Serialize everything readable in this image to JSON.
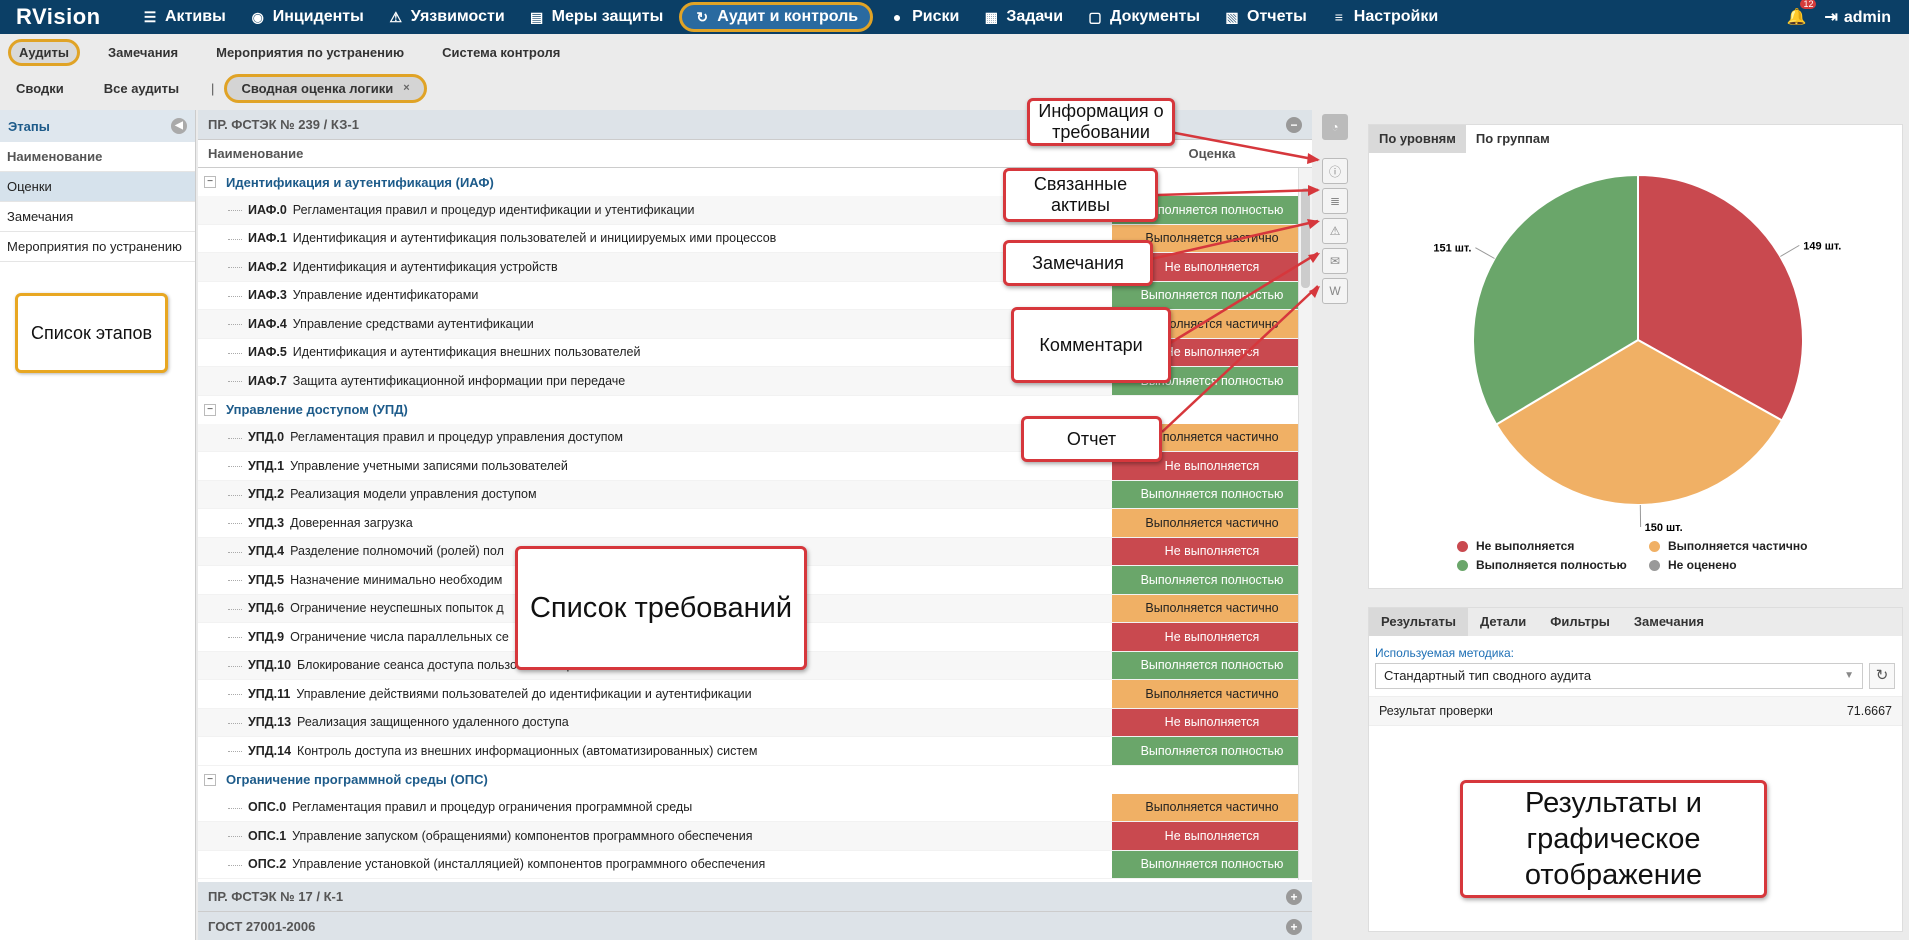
{
  "app": {
    "logo": "RVision"
  },
  "topnav": {
    "items": [
      {
        "label": "Активы",
        "icon": "database-icon",
        "glyph": "☰"
      },
      {
        "label": "Инциденты",
        "icon": "target-icon",
        "glyph": "◉"
      },
      {
        "label": "Уязвимости",
        "icon": "warning-icon",
        "glyph": "⚠"
      },
      {
        "label": "Меры защиты",
        "icon": "shield-list-icon",
        "glyph": "▤"
      },
      {
        "label": "Аудит и контроль",
        "icon": "audit-refresh-icon",
        "glyph": "↻"
      },
      {
        "label": "Риски",
        "icon": "alert-circle-icon",
        "glyph": "●"
      },
      {
        "label": "Задачи",
        "icon": "tasks-icon",
        "glyph": "▦"
      },
      {
        "label": "Документы",
        "icon": "document-icon",
        "glyph": "▢"
      },
      {
        "label": "Отчеты",
        "icon": "report-icon",
        "glyph": "▧"
      },
      {
        "label": "Настройки",
        "icon": "menu-icon",
        "glyph": "≡"
      }
    ],
    "notifications_count": "12",
    "user": "admin"
  },
  "subtabs": [
    "Аудиты",
    "Замечания",
    "Мероприятия по устранению",
    "Система контроля"
  ],
  "subsub": {
    "summaries": "Сводки",
    "all_audits": "Все аудиты",
    "separator": "|",
    "active_tab": "Сводная оценка логики",
    "close": "×"
  },
  "stages": {
    "title": "Этапы",
    "header": "Наименование",
    "items": [
      "Оценки",
      "Замечания",
      "Мероприятия по устранению"
    ]
  },
  "requirements": {
    "section_title": "ПР. ФСТЭК № 239 / КЗ-1",
    "col_name": "Наименование",
    "col_score": "Оценка",
    "groups": [
      {
        "title": "Идентификация и аутентификация (ИАФ)",
        "rows": [
          {
            "code": "ИАФ.0",
            "name": "Регламентация правил и процедур идентификации и утентификации",
            "status": "Выполняется полностью",
            "cls": "st-green"
          },
          {
            "code": "ИАФ.1",
            "name": "Идентификация и аутентификация пользователей и инициируемых ими процессов",
            "status": "Выполняется частично",
            "cls": "st-orange"
          },
          {
            "code": "ИАФ.2",
            "name": "Идентификация и аутентификация устройств",
            "status": "Не выполняется",
            "cls": "st-red"
          },
          {
            "code": "ИАФ.3",
            "name": "Управление идентификаторами",
            "status": "Выполняется полностью",
            "cls": "st-green"
          },
          {
            "code": "ИАФ.4",
            "name": "Управление средствами аутентификации",
            "status": "Выполняется частично",
            "cls": "st-orange"
          },
          {
            "code": "ИАФ.5",
            "name": "Идентификация и аутентификация внешних пользователей",
            "status": "Не выполняется",
            "cls": "st-red"
          },
          {
            "code": "ИАФ.7",
            "name": "Защита аутентификационной информации при передаче",
            "status": "Выполняется полностью",
            "cls": "st-green"
          }
        ]
      },
      {
        "title": "Управление доступом (УПД)",
        "rows": [
          {
            "code": "УПД.0",
            "name": "Регламентация правил и процедур управления доступом",
            "status": "Выполняется частично",
            "cls": "st-orange"
          },
          {
            "code": "УПД.1",
            "name": "Управление учетными записями пользователей",
            "status": "Не выполняется",
            "cls": "st-red"
          },
          {
            "code": "УПД.2",
            "name": "Реализация модели управления доступом",
            "status": "Выполняется полностью",
            "cls": "st-green"
          },
          {
            "code": "УПД.3",
            "name": "Доверенная загрузка",
            "status": "Выполняется частично",
            "cls": "st-orange"
          },
          {
            "code": "УПД.4",
            "name": "Разделение полномочий (ролей) пол",
            "status": "Не выполняется",
            "cls": "st-red"
          },
          {
            "code": "УПД.5",
            "name": "Назначение минимально необходим",
            "status": "Выполняется полностью",
            "cls": "st-green"
          },
          {
            "code": "УПД.6",
            "name": "Ограничение неуспешных попыток д                                                         ) систему",
            "status": "Выполняется частично",
            "cls": "st-orange"
          },
          {
            "code": "УПД.9",
            "name": "Ограничение числа параллельных се",
            "status": "Не выполняется",
            "cls": "st-red"
          },
          {
            "code": "УПД.10",
            "name": "Блокирование сеанса доступа пользователя при неактивности",
            "status": "Выполняется полностью",
            "cls": "st-green"
          },
          {
            "code": "УПД.11",
            "name": "Управление действиями пользователей до идентификации и аутентификации",
            "status": "Выполняется частично",
            "cls": "st-orange"
          },
          {
            "code": "УПД.13",
            "name": "Реализация защищенного удаленного доступа",
            "status": "Не выполняется",
            "cls": "st-red"
          },
          {
            "code": "УПД.14",
            "name": "Контроль доступа из внешних информационных (автоматизированных) систем",
            "status": "Выполняется полностью",
            "cls": "st-green"
          }
        ]
      },
      {
        "title": "Ограничение программной среды (ОПС)",
        "rows": [
          {
            "code": "ОПС.0",
            "name": "Регламентация правил и процедур ограничения программной среды",
            "status": "Выполняется частично",
            "cls": "st-orange"
          },
          {
            "code": "ОПС.1",
            "name": "Управление запуском (обращениями) компонентов программного обеспечения",
            "status": "Не выполняется",
            "cls": "st-red"
          },
          {
            "code": "ОПС.2",
            "name": "Управление установкой (инсталляцией) компонентов программного обеспечения",
            "status": "Выполняется полностью",
            "cls": "st-green"
          }
        ]
      }
    ],
    "collapsed_sections": [
      "ПР. ФСТЭК № 17 / К-1",
      "ГОСТ 27001-2006"
    ]
  },
  "chart_tabs": [
    "По уровням",
    "По группам"
  ],
  "chart_data": {
    "type": "pie",
    "slices": [
      {
        "label": "Не выполняется",
        "value": 149,
        "display": "149 шт.",
        "color": "#c9494f"
      },
      {
        "label": "Выполняется частично",
        "value": 150,
        "display": "150 шт.",
        "color": "#f0b065"
      },
      {
        "label": "Выполняется полностью",
        "value": 151,
        "display": "151 шт.",
        "color": "#6aa66a"
      },
      {
        "label": "Не оценено",
        "value": 0,
        "display": "",
        "color": "#999999"
      }
    ],
    "legend_placement": "bottom"
  },
  "results": {
    "tabs": [
      "Результаты",
      "Детали",
      "Фильтры",
      "Замечания"
    ],
    "method_label": "Используемая методика:",
    "method_value": "Стандартный тип сводного аудита",
    "check_label": "Результат проверки",
    "check_value": "71.6667"
  },
  "callouts": {
    "info": "Информация о требовании",
    "assets": "Связанные активы",
    "remarks": "Замечания",
    "comments": "Комментари",
    "report": "Отчет",
    "req_list": "Список требований",
    "results": "Результаты и графическое отображение",
    "stages_list": "Список этапов"
  },
  "colors": {
    "nav_bg": "#0b3f66",
    "highlight": "#e0a326",
    "callout_border": "#d6373c"
  }
}
